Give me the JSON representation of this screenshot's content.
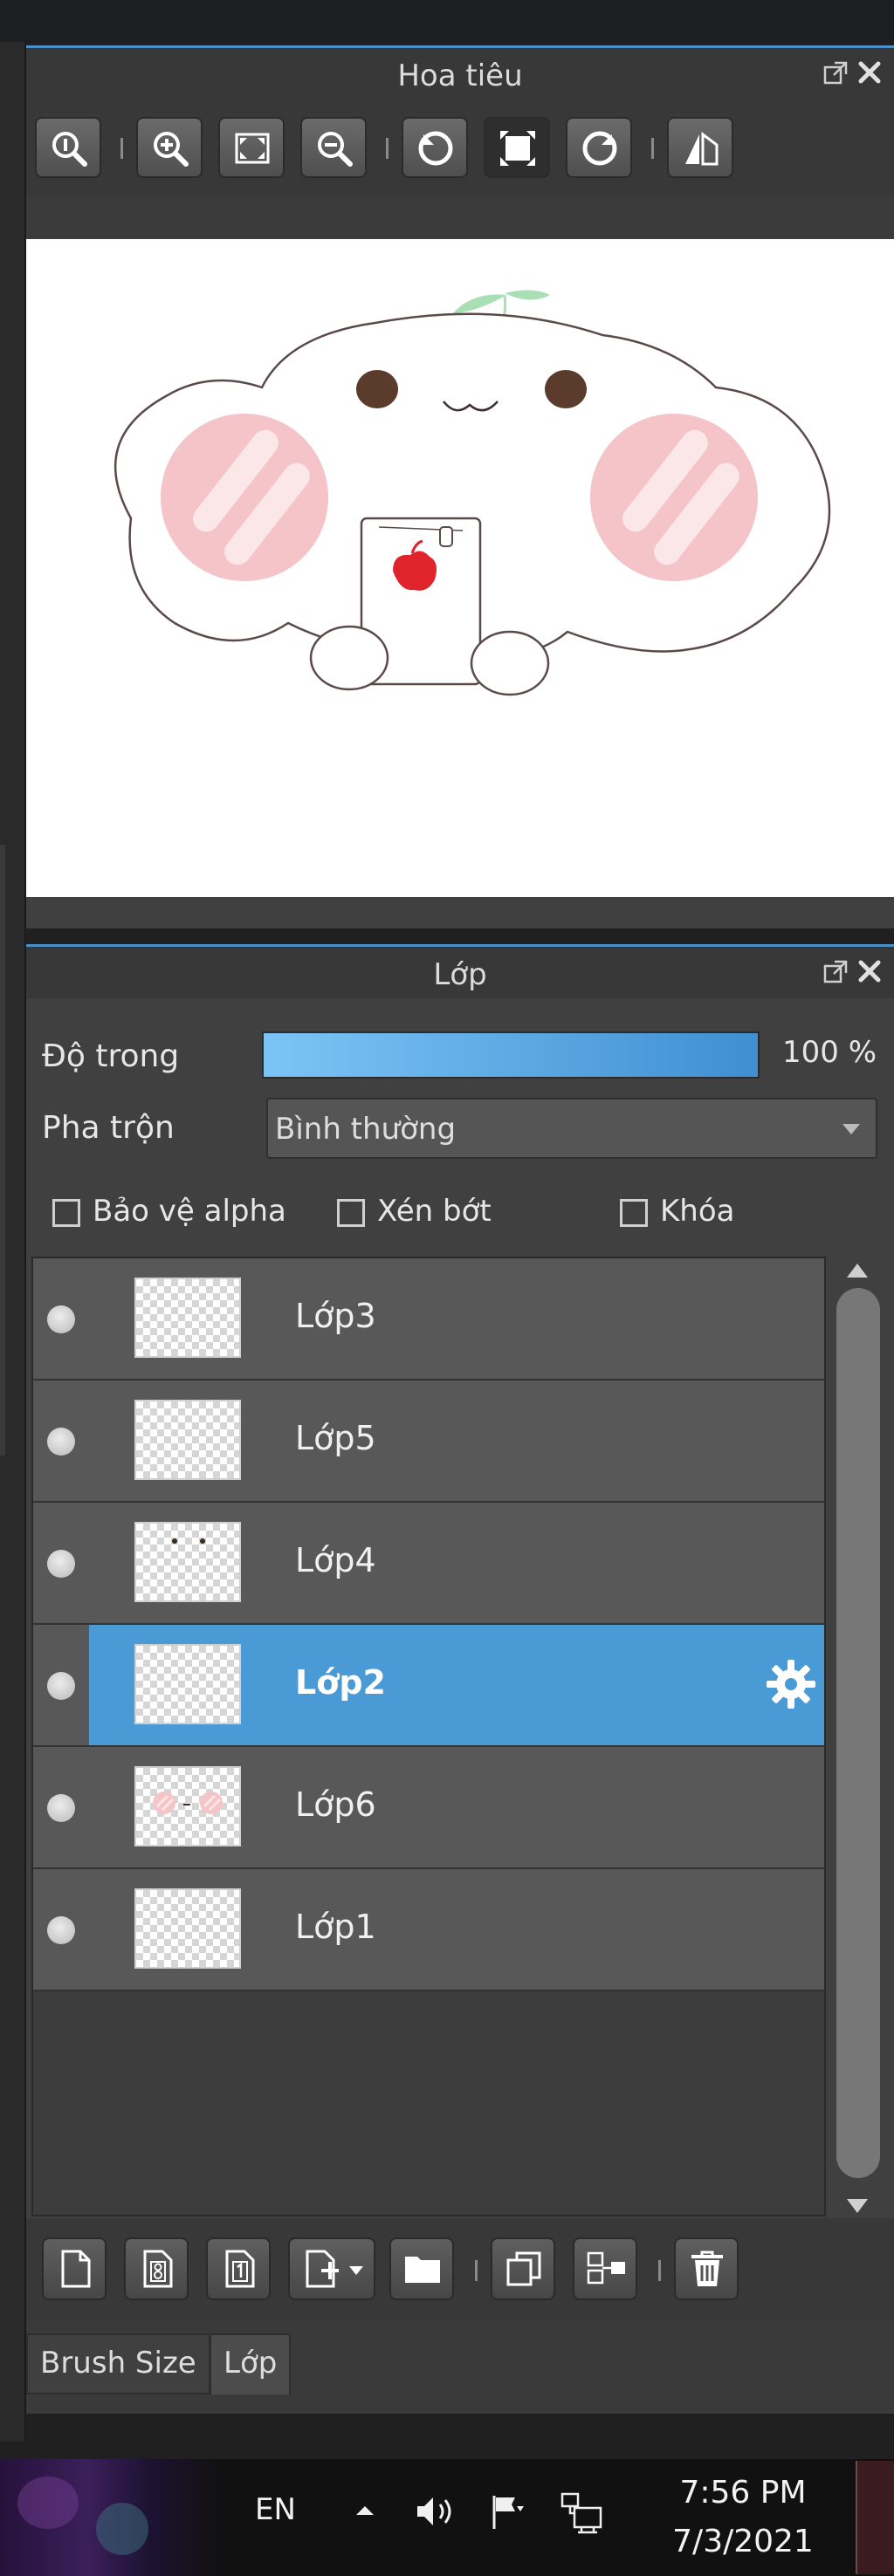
{
  "navigator": {
    "title": "Hoa tiêu",
    "toolbar": [
      "zoom-actual",
      "zoom-in",
      "fit-window",
      "zoom-out",
      "rotate-left",
      "reset-view",
      "rotate-right",
      "flip-horizontal"
    ]
  },
  "layers": {
    "title": "Lớp",
    "opacity_label": "Độ trong",
    "opacity_value": "100 %",
    "opacity_fraction": 1.0,
    "blend_label": "Pha trộn",
    "blend_value": "Bình thường",
    "checkboxes": [
      {
        "label": "Bảo vệ alpha",
        "checked": false
      },
      {
        "label": "Xén bớt",
        "checked": false
      },
      {
        "label": "Khóa",
        "checked": false
      }
    ],
    "items": [
      {
        "name": "Lớp3",
        "active": false
      },
      {
        "name": "Lớp5",
        "active": false
      },
      {
        "name": "Lớp4",
        "active": false
      },
      {
        "name": "Lớp2",
        "active": true
      },
      {
        "name": "Lớp6",
        "active": false
      },
      {
        "name": "Lớp1",
        "active": false
      }
    ]
  },
  "tabs": [
    "Brush Size",
    "Lớp"
  ],
  "taskbar": {
    "language": "EN",
    "time": "7:56 PM",
    "date": "7/3/2021"
  },
  "colors": {
    "accent": "#4a9ad6",
    "panel": "#404040",
    "title_accent": "#4a8fc9"
  }
}
